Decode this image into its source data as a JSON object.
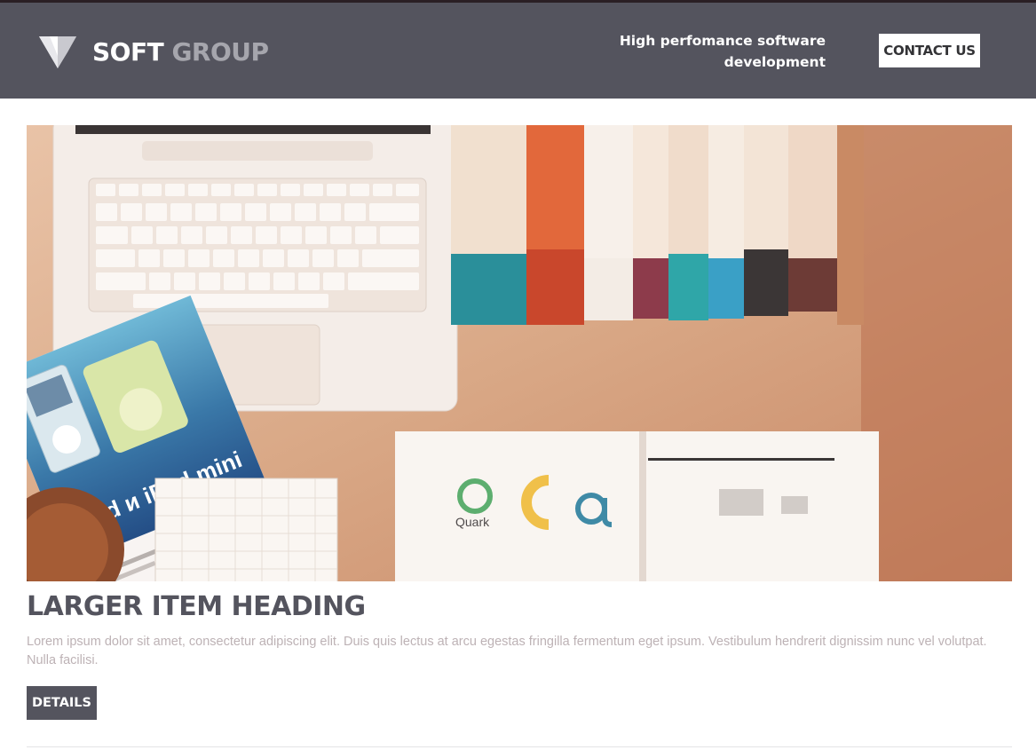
{
  "header": {
    "logo": {
      "word1": "SOFT",
      "word2": "GROUP",
      "icon": "triangle-logo-icon"
    },
    "tagline": "High perfomance software development",
    "contact_label": "CONTACT US"
  },
  "hero_image": {
    "subject": "desk-with-laptop-books-magazine",
    "magazine_text": "iPod и iPod mini",
    "book_logo_text": "Quark"
  },
  "item": {
    "heading": "LARGER ITEM HEADING",
    "description": "Lorem ipsum dolor sit amet, consectetur adipiscing elit. Duis quis lectus at arcu egestas fringilla fermentum eget ipsum. Vestibulum hendrerit dignissim nunc vel volutpat. Nulla facilisi.",
    "details_label": "DETAILS"
  },
  "colors": {
    "header_bg": "#54545e",
    "logo_secondary": "#a6a6ad",
    "heading": "#54545e",
    "description": "#bdb2b5",
    "button_bg": "#54545e"
  }
}
